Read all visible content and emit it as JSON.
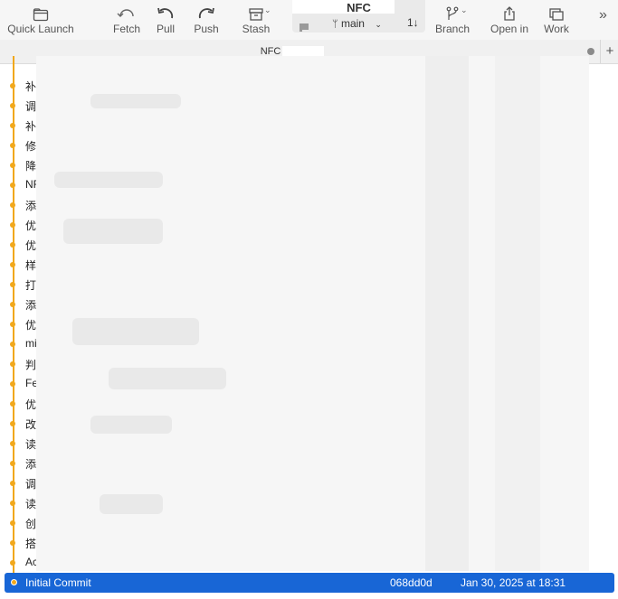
{
  "toolbar": {
    "quick_launch": "Quick Launch",
    "fetch": "Fetch",
    "pull": "Pull",
    "push": "Push",
    "stash": "Stash",
    "branch": "Branch",
    "open_in": "Open in",
    "work": "Work"
  },
  "repo": {
    "name": "NFC",
    "branch": "main",
    "sort_glyph": "1↓"
  },
  "tab": {
    "label": "NFC",
    "add": "+"
  },
  "commits": [
    {
      "message": "补"
    },
    {
      "message": "调"
    },
    {
      "message": "补"
    },
    {
      "message": "修"
    },
    {
      "message": "降"
    },
    {
      "message": "NF"
    },
    {
      "message": "添"
    },
    {
      "message": "优"
    },
    {
      "message": "优"
    },
    {
      "message": "样"
    },
    {
      "message": "打"
    },
    {
      "message": "添"
    },
    {
      "message": "优"
    },
    {
      "message": "mi"
    },
    {
      "message": "判"
    },
    {
      "message": "Fe"
    },
    {
      "message": "优"
    },
    {
      "message": "改"
    },
    {
      "message": "读"
    },
    {
      "message": "添"
    },
    {
      "message": "调"
    },
    {
      "message": "读"
    },
    {
      "message": "创"
    },
    {
      "message": "搭"
    },
    {
      "message": "Ac"
    }
  ],
  "selected_commit": {
    "message": "Initial Commit",
    "hash": "068dd0d",
    "date": "Jan 30, 2025 at 18:31"
  },
  "colors": {
    "graph": "#f1a81c",
    "selection": "#1866d6"
  }
}
